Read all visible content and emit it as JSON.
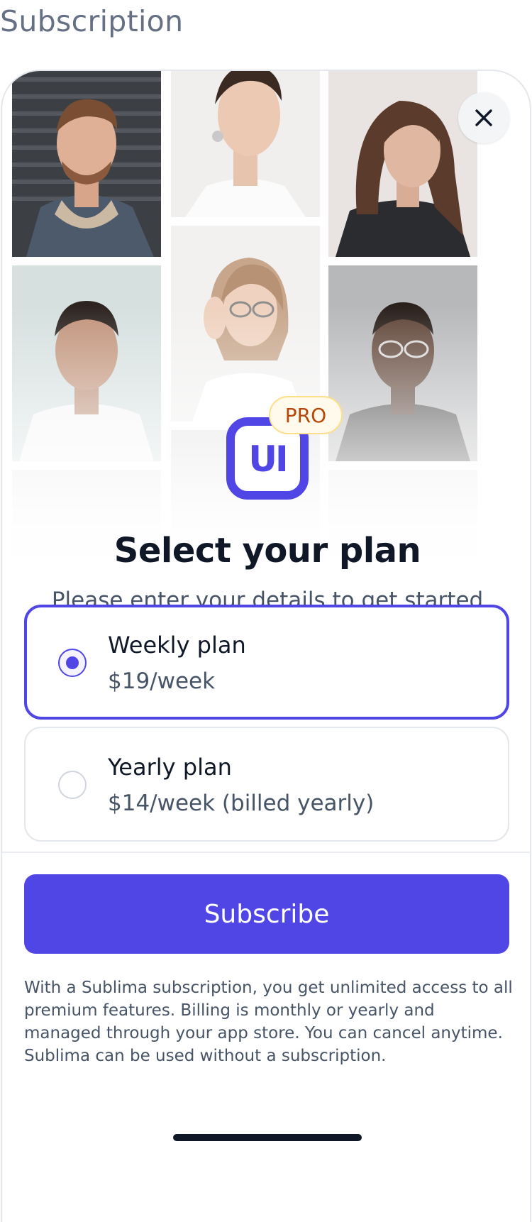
{
  "page": {
    "title": "Subscription"
  },
  "hero": {
    "badge": "PRO",
    "logo_text": "UI",
    "close_icon": "close-icon"
  },
  "heading": "Select your plan",
  "subheading": "Please enter your details to get started",
  "plans": [
    {
      "name": "Weekly plan",
      "price": "$19/week",
      "selected": true
    },
    {
      "name": "Yearly plan",
      "price": "$14/week (billed yearly)",
      "selected": false
    }
  ],
  "subscribe_label": "Subscribe",
  "legal": "With a Sublima subscription, you get unlimited access to all premium features. Billing is monthly or yearly and managed through your app store. You can cancel anytime. Sublima can be used without a subscription.",
  "colors": {
    "accent": "#4f46e5",
    "badge_bg": "#fffaeb",
    "badge_text": "#b54708"
  }
}
